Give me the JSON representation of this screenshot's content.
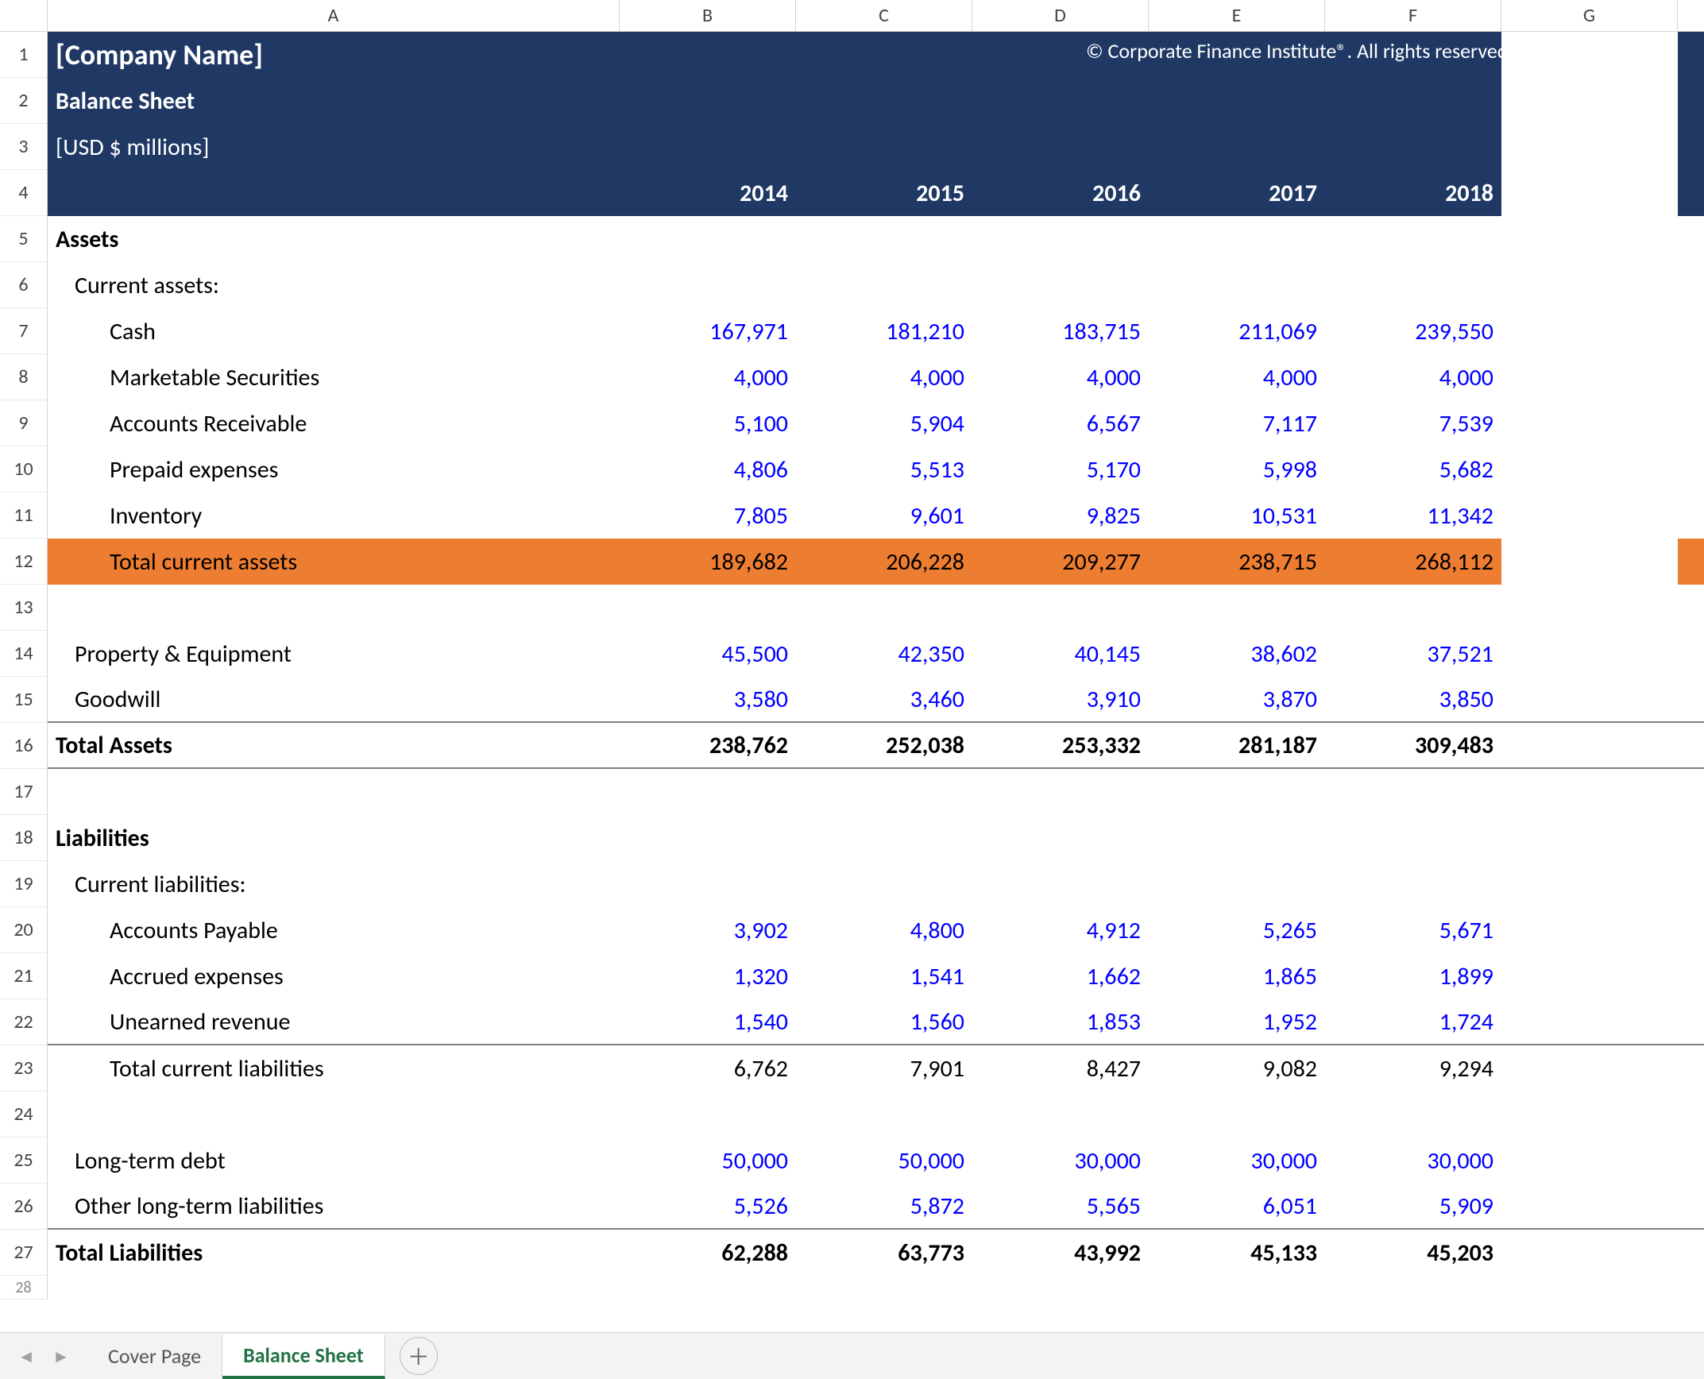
{
  "columns": {
    "rowHead": "",
    "letters": [
      "A",
      "B",
      "C",
      "D",
      "E",
      "F",
      "G"
    ]
  },
  "header": {
    "company": "[Company Name]",
    "title": "Balance Sheet",
    "units": "[USD $ millions]",
    "copyright": "© Corporate Finance Institute®. All rights reserved."
  },
  "years": [
    "2014",
    "2015",
    "2016",
    "2017",
    "2018"
  ],
  "rows": {
    "r5": {
      "n": "5",
      "label": "Assets",
      "vals": [
        "",
        "",
        "",
        "",
        ""
      ]
    },
    "r6": {
      "n": "6",
      "label": "Current assets:",
      "vals": [
        "",
        "",
        "",
        "",
        ""
      ]
    },
    "r7": {
      "n": "7",
      "label": "Cash",
      "vals": [
        "167,971",
        "181,210",
        "183,715",
        "211,069",
        "239,550"
      ]
    },
    "r8": {
      "n": "8",
      "label": "Marketable Securities",
      "vals": [
        "4,000",
        "4,000",
        "4,000",
        "4,000",
        "4,000"
      ]
    },
    "r9": {
      "n": "9",
      "label": "Accounts Receivable",
      "vals": [
        "5,100",
        "5,904",
        "6,567",
        "7,117",
        "7,539"
      ]
    },
    "r10": {
      "n": "10",
      "label": "Prepaid expenses",
      "vals": [
        "4,806",
        "5,513",
        "5,170",
        "5,998",
        "5,682"
      ]
    },
    "r11": {
      "n": "11",
      "label": "Inventory",
      "vals": [
        "7,805",
        "9,601",
        "9,825",
        "10,531",
        "11,342"
      ]
    },
    "r12": {
      "n": "12",
      "label": "Total current assets",
      "vals": [
        "189,682",
        "206,228",
        "209,277",
        "238,715",
        "268,112"
      ]
    },
    "r13": {
      "n": "13",
      "label": "",
      "vals": [
        "",
        "",
        "",
        "",
        ""
      ]
    },
    "r14": {
      "n": "14",
      "label": "Property & Equipment",
      "vals": [
        "45,500",
        "42,350",
        "40,145",
        "38,602",
        "37,521"
      ]
    },
    "r15": {
      "n": "15",
      "label": "Goodwill",
      "vals": [
        "3,580",
        "3,460",
        "3,910",
        "3,870",
        "3,850"
      ]
    },
    "r16": {
      "n": "16",
      "label": "Total Assets",
      "vals": [
        "238,762",
        "252,038",
        "253,332",
        "281,187",
        "309,483"
      ]
    },
    "r17": {
      "n": "17",
      "label": "",
      "vals": [
        "",
        "",
        "",
        "",
        ""
      ]
    },
    "r18": {
      "n": "18",
      "label": "Liabilities",
      "vals": [
        "",
        "",
        "",
        "",
        ""
      ]
    },
    "r19": {
      "n": "19",
      "label": "Current liabilities:",
      "vals": [
        "",
        "",
        "",
        "",
        ""
      ]
    },
    "r20": {
      "n": "20",
      "label": "Accounts Payable",
      "vals": [
        "3,902",
        "4,800",
        "4,912",
        "5,265",
        "5,671"
      ]
    },
    "r21": {
      "n": "21",
      "label": "Accrued expenses",
      "vals": [
        "1,320",
        "1,541",
        "1,662",
        "1,865",
        "1,899"
      ]
    },
    "r22": {
      "n": "22",
      "label": "Unearned revenue",
      "vals": [
        "1,540",
        "1,560",
        "1,853",
        "1,952",
        "1,724"
      ]
    },
    "r23": {
      "n": "23",
      "label": "Total current liabilities",
      "vals": [
        "6,762",
        "7,901",
        "8,427",
        "9,082",
        "9,294"
      ]
    },
    "r24": {
      "n": "24",
      "label": "",
      "vals": [
        "",
        "",
        "",
        "",
        ""
      ]
    },
    "r25": {
      "n": "25",
      "label": "Long-term debt",
      "vals": [
        "50,000",
        "50,000",
        "30,000",
        "30,000",
        "30,000"
      ]
    },
    "r26": {
      "n": "26",
      "label": "Other long-term liabilities",
      "vals": [
        "5,526",
        "5,872",
        "5,565",
        "6,051",
        "5,909"
      ]
    },
    "r27": {
      "n": "27",
      "label": "Total Liabilities",
      "vals": [
        "62,288",
        "63,773",
        "43,992",
        "45,133",
        "45,203"
      ]
    },
    "r28": {
      "n": "28",
      "label": "",
      "vals": [
        "",
        "",
        "",
        "",
        ""
      ]
    }
  },
  "footer": {
    "tabs": [
      {
        "label": "Cover Page",
        "active": false
      },
      {
        "label": "Balance Sheet",
        "active": true
      }
    ],
    "add": "＋"
  },
  "nav": {
    "prev": "◄",
    "next": "►"
  }
}
